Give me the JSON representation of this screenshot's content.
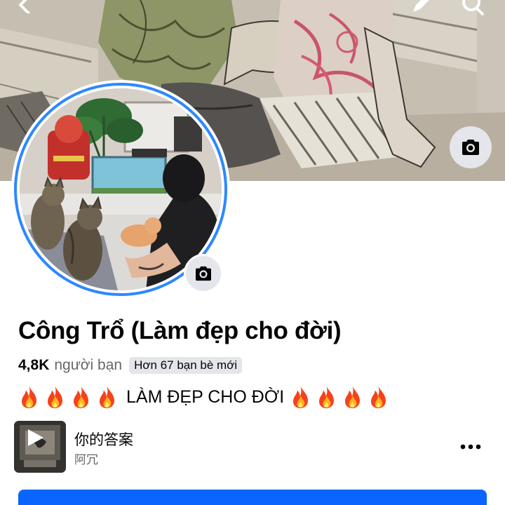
{
  "header": {
    "back_icon": "chevron-left-icon",
    "edit_icon": "pencil-icon",
    "search_icon": "search-icon"
  },
  "cover": {
    "camera_icon": "camera-icon"
  },
  "avatar": {
    "camera_icon": "camera-icon",
    "ring_color": "#2d88ff"
  },
  "profile": {
    "name": "Công Trổ (Làm đẹp cho đời)",
    "friend_count": "4,8K",
    "friend_label": "người bạn",
    "new_friends_badge": "Hơn 67 bạn bè mới",
    "bio_text": "LÀM ĐẸP CHO ĐỜI",
    "bio_icon": "fire-emoji"
  },
  "music": {
    "title": "你的答案",
    "artist": "阿冗",
    "play_icon": "play-icon",
    "more_icon": "ellipsis-icon"
  },
  "colors": {
    "accent": "#0866ff",
    "secondary_text": "#65676b",
    "badge_bg": "#e4e6eb"
  }
}
